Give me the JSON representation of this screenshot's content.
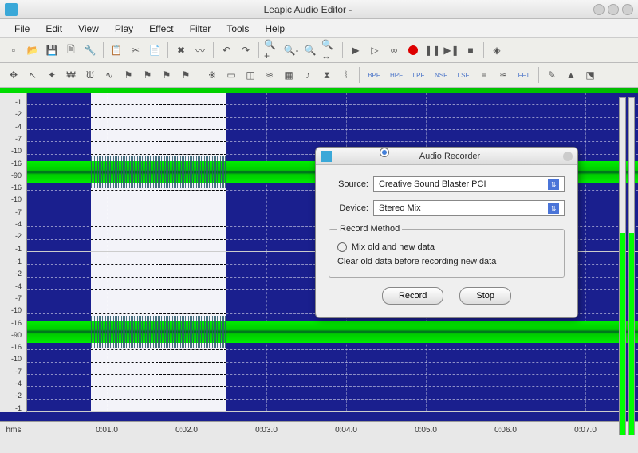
{
  "title": "Leapic Audio Editor -",
  "menu": [
    "File",
    "Edit",
    "View",
    "Play",
    "Effect",
    "Filter",
    "Tools",
    "Help"
  ],
  "toolbar1": [
    {
      "n": "new-icon",
      "g": "▫"
    },
    {
      "n": "open-icon",
      "g": "📂"
    },
    {
      "n": "save-icon",
      "g": "💾"
    },
    {
      "n": "save-as-icon",
      "g": "🗎"
    },
    {
      "n": "properties-icon",
      "g": "🔧"
    },
    {
      "sep": true
    },
    {
      "n": "copy-icon",
      "g": "📋"
    },
    {
      "n": "cut-icon",
      "g": "✂"
    },
    {
      "n": "paste-icon",
      "g": "📄"
    },
    {
      "sep": true
    },
    {
      "n": "delete-icon",
      "g": "✖"
    },
    {
      "n": "trim-icon",
      "g": "〰"
    },
    {
      "sep": true
    },
    {
      "n": "undo-icon",
      "g": "↶"
    },
    {
      "n": "redo-icon",
      "g": "↷"
    },
    {
      "sep": true
    },
    {
      "n": "zoom-in-icon",
      "g": "🔍+"
    },
    {
      "n": "zoom-out-icon",
      "g": "🔍-"
    },
    {
      "n": "zoom-sel-icon",
      "g": "🔍"
    },
    {
      "n": "zoom-fit-icon",
      "g": "🔍↔"
    },
    {
      "sep": true
    },
    {
      "n": "play-icon",
      "g": "▶"
    },
    {
      "n": "play-section-icon",
      "g": "▷"
    },
    {
      "n": "loop-icon",
      "g": "∞"
    },
    {
      "n": "record-icon",
      "g": "●",
      "rec": true
    },
    {
      "n": "pause-icon",
      "g": "❚❚"
    },
    {
      "n": "next-icon",
      "g": "▶❚"
    },
    {
      "n": "stop-icon",
      "g": "■"
    },
    {
      "sep": true
    },
    {
      "n": "help-icon",
      "g": "◈"
    }
  ],
  "toolbar2": [
    {
      "n": "select-icon",
      "g": "✥"
    },
    {
      "n": "pointer-icon",
      "g": "↖"
    },
    {
      "n": "marker-icon",
      "g": "✦"
    },
    {
      "n": "wave1-icon",
      "g": "₩"
    },
    {
      "n": "wave2-icon",
      "g": "ᙎ"
    },
    {
      "n": "wave3-icon",
      "g": "∿"
    },
    {
      "n": "flag1-icon",
      "g": "⚑"
    },
    {
      "n": "flag2-icon",
      "g": "⚑"
    },
    {
      "n": "flag3-icon",
      "g": "⚑"
    },
    {
      "n": "flag4-icon",
      "g": "⚑"
    },
    {
      "sep": true
    },
    {
      "n": "fx1-icon",
      "g": "※"
    },
    {
      "n": "fx2-icon",
      "g": "▭"
    },
    {
      "n": "fx3-icon",
      "g": "◫"
    },
    {
      "n": "fx4-icon",
      "g": "≋"
    },
    {
      "n": "fx5-icon",
      "g": "▦"
    },
    {
      "n": "fx6-icon",
      "g": "♪"
    },
    {
      "n": "fx7-icon",
      "g": "⧗"
    },
    {
      "n": "fx8-icon",
      "g": "⦚"
    },
    {
      "sep": true
    },
    {
      "n": "bpf-icon",
      "g": "BPF",
      "txt": true
    },
    {
      "n": "hpf-icon",
      "g": "HPF",
      "txt": true
    },
    {
      "n": "lpf-icon",
      "g": "LPF",
      "txt": true
    },
    {
      "n": "nsf-icon",
      "g": "NSF",
      "txt": true
    },
    {
      "n": "lsf-icon",
      "g": "LSF",
      "txt": true
    },
    {
      "n": "eq1-icon",
      "g": "≡"
    },
    {
      "n": "eq2-icon",
      "g": "≊"
    },
    {
      "n": "fft-icon",
      "g": "FFT",
      "txt": true
    },
    {
      "sep": true
    },
    {
      "n": "tool1-icon",
      "g": "✎"
    },
    {
      "n": "tool2-icon",
      "g": "▲"
    },
    {
      "n": "tool3-icon",
      "g": "⬔"
    }
  ],
  "db_labels": [
    "-1",
    "-2",
    "-4",
    "-7",
    "-10",
    "-16",
    "-90",
    "-16",
    "-10",
    "-7",
    "-4",
    "-2",
    "-1"
  ],
  "time_labels": [
    "0:01.0",
    "0:02.0",
    "0:03.0",
    "0:04.0",
    "0:05.0",
    "0:06.0",
    "0:07.0"
  ],
  "time_unit": "hms",
  "dialog": {
    "title": "Audio Recorder",
    "source_label": "Source:",
    "source_value": "Creative Sound Blaster PCI",
    "device_label": "Device:",
    "device_value": "Stereo Mix",
    "method_legend": "Record Method",
    "opt_mix": "Mix old and new data",
    "opt_clear": "Clear old data before recording new data",
    "selected": "clear",
    "btn_record": "Record",
    "btn_stop": "Stop"
  }
}
